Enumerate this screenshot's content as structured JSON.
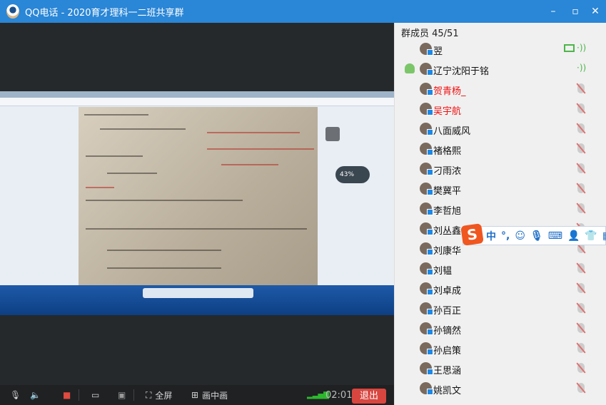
{
  "window": {
    "title": "QQ电话 - 2020育才理科一二班共享群",
    "controls": [
      "minimize",
      "maximize",
      "close"
    ]
  },
  "toolbar": {
    "fullscreen": "全屏",
    "pip": "画中画",
    "timer": "02:01",
    "exit": "退出",
    "mic_icon": "microphone-icon",
    "speaker_icon": "speaker-icon",
    "camera_icon": "camera-off-icon",
    "share_icon": "screen-share-icon",
    "present_icon": "presentation-icon"
  },
  "shared_screen": {
    "badge": "43%"
  },
  "panel": {
    "header": "群成员 45/51",
    "members": [
      {
        "name": "翌",
        "status": "speaking",
        "sharing": true
      },
      {
        "name": "辽宁沈阳于铭",
        "status": "speaking",
        "host": true
      },
      {
        "name": "贺青杨_",
        "status": "muted",
        "red": true
      },
      {
        "name": "吴宇航",
        "status": "muted",
        "red": true
      },
      {
        "name": "八面威风",
        "status": "muted"
      },
      {
        "name": "褚格熙",
        "status": "muted"
      },
      {
        "name": "刁雨浓",
        "status": "muted"
      },
      {
        "name": "樊冀平",
        "status": "muted"
      },
      {
        "name": "李哲旭",
        "status": "muted"
      },
      {
        "name": "刘丛鑫",
        "status": "muted"
      },
      {
        "name": "刘康华",
        "status": "muted"
      },
      {
        "name": "刘韫",
        "status": "muted"
      },
      {
        "name": "刘卓成",
        "status": "muted"
      },
      {
        "name": "孙百正",
        "status": "muted"
      },
      {
        "name": "孙镝然",
        "status": "muted"
      },
      {
        "name": "孙启策",
        "status": "muted"
      },
      {
        "name": "王思涵",
        "status": "muted"
      },
      {
        "name": "姚凯文",
        "status": "muted"
      }
    ]
  },
  "ime": {
    "logo": "S",
    "mode": "中",
    "punct": "°,",
    "icons": [
      "emoji-icon",
      "voice-icon",
      "keyboard-icon",
      "user-icon",
      "skin-icon",
      "grid-icon"
    ]
  },
  "colors": {
    "titlebar": "#2a86d6",
    "exit": "#d9463f",
    "speaking": "#4cb548",
    "red_name": "#f01010"
  }
}
